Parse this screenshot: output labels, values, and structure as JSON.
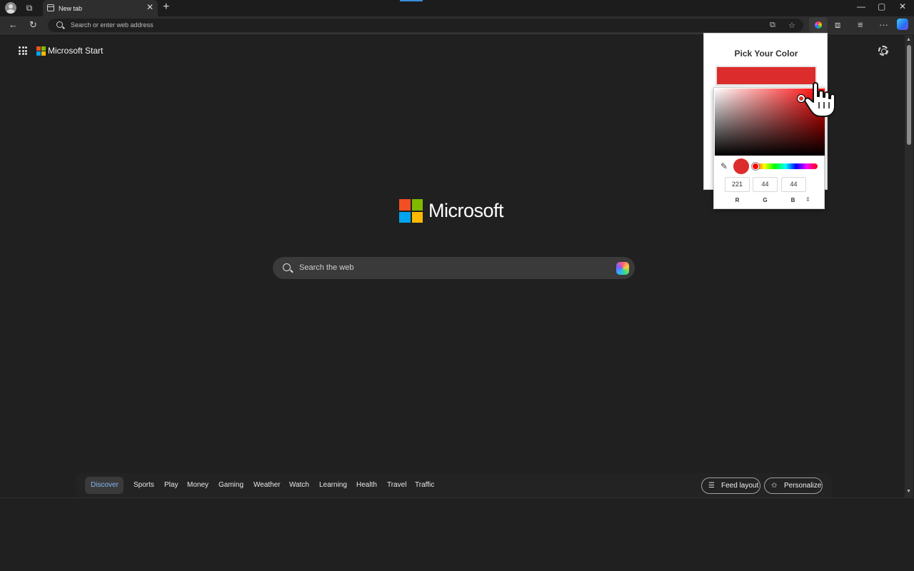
{
  "window": {
    "tab_title": "New tab",
    "new_tab_glyph": "+",
    "close_glyph": "✕",
    "minimize_glyph": "—",
    "maximize_glyph": "▢",
    "window_close_glyph": "✕"
  },
  "toolbar": {
    "back_glyph": "←",
    "refresh_glyph": "↻",
    "address_placeholder": "Search or enter web address",
    "read_aloud_glyph": "⧉",
    "favorite_glyph": "☆",
    "extensions_glyph": "⧈",
    "favorites_glyph": "≡",
    "more_glyph": "···"
  },
  "page": {
    "brand": "Microsoft Start",
    "hero_text": "Microsoft",
    "search_placeholder": "Search the web"
  },
  "bottom_nav": {
    "active": "Discover",
    "items": [
      "Sports",
      "Play",
      "Money",
      "Gaming",
      "Weather",
      "Watch",
      "Learning",
      "Health",
      "Travel",
      "Traffic"
    ],
    "feed_layout": "Feed layout",
    "personalize": "Personalize"
  },
  "color_picker": {
    "title": "Pick Your Color",
    "selected_color": "#dd2c2c",
    "hue_color": "#ff0000",
    "r": "221",
    "g": "44",
    "b": "44",
    "labels": [
      "R",
      "G",
      "B"
    ],
    "mode_toggle_glyph": "⇕"
  },
  "icons": [
    "avatar-icon",
    "workspaces-icon",
    "tab-page-icon",
    "search-icon",
    "copilot-icon",
    "apps-grid-icon",
    "settings-gear-icon",
    "eyedropper-icon",
    "hand-cursor-icon"
  ]
}
